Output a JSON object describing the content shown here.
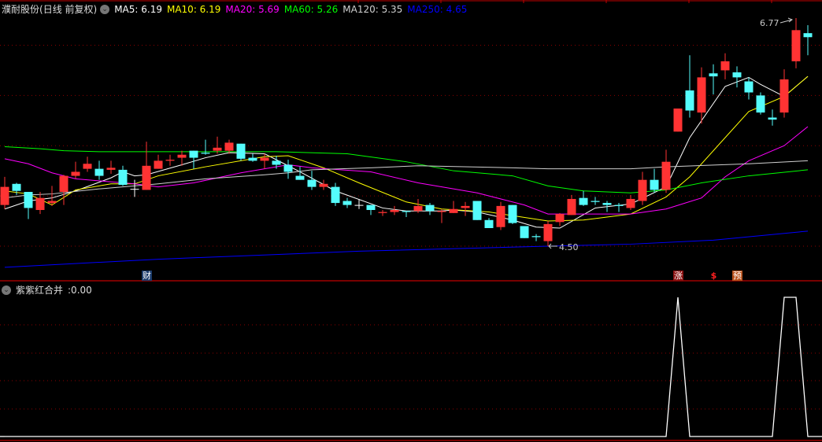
{
  "header": {
    "stock_name": "濮耐股份",
    "period": "(日线 前复权)",
    "ma_items": [
      {
        "label": "MA5: 6.19",
        "color": "#ffffff"
      },
      {
        "label": "MA10: 6.19",
        "color": "#ffff00"
      },
      {
        "label": "MA20: 5.69",
        "color": "#ff00ff"
      },
      {
        "label": "MA60: 5.26",
        "color": "#00ff00"
      },
      {
        "label": "MA120: 5.35",
        "color": "#d0d0d0"
      },
      {
        "label": "MA250: 4.65",
        "color": "#0000ff"
      }
    ]
  },
  "annotations": {
    "high_label": "6.77",
    "low_label": "4.50"
  },
  "markers": [
    {
      "text": "财",
      "index": 12,
      "bg": "#1a3a6a",
      "color": "#ffffff"
    },
    {
      "text": "涨",
      "index": 57,
      "bg": "#8a1010",
      "color": "#ffffff"
    },
    {
      "text": "$",
      "index": 60,
      "bg": "",
      "color": "#ff2020"
    },
    {
      "text": "预",
      "index": 62,
      "bg": "#b8501a",
      "color": "#ffffff"
    }
  ],
  "indicator": {
    "name": "紫紫红合并",
    "value_label": ":0.00"
  },
  "colors": {
    "up": "#ff3333",
    "down": "#54fcfc",
    "grid": "#8b0000",
    "border": "#c00000"
  },
  "chart_data": {
    "type": "candlestick",
    "price_range": [
      4.5,
      6.77
    ],
    "candles_ohlc": [
      [
        4.91,
        5.19,
        4.87,
        5.09
      ],
      [
        5.12,
        5.13,
        5.01,
        5.05
      ],
      [
        5.04,
        5.04,
        4.77,
        4.88
      ],
      [
        4.86,
        5.04,
        4.82,
        4.98
      ],
      [
        4.93,
        5.1,
        4.9,
        4.95
      ],
      [
        5.04,
        5.21,
        4.91,
        5.2
      ],
      [
        5.2,
        5.34,
        5.17,
        5.24
      ],
      [
        5.27,
        5.39,
        5.24,
        5.32
      ],
      [
        5.27,
        5.35,
        5.16,
        5.2
      ],
      [
        5.26,
        5.35,
        5.22,
        5.28
      ],
      [
        5.26,
        5.3,
        5.1,
        5.11
      ],
      [
        5.07,
        5.16,
        4.99,
        5.07
      ],
      [
        5.06,
        5.54,
        5.06,
        5.3
      ],
      [
        5.27,
        5.41,
        5.27,
        5.35
      ],
      [
        5.35,
        5.41,
        5.3,
        5.36
      ],
      [
        5.38,
        5.45,
        5.3,
        5.41
      ],
      [
        5.45,
        5.45,
        5.27,
        5.38
      ],
      [
        5.43,
        5.56,
        5.41,
        5.42
      ],
      [
        5.45,
        5.59,
        5.42,
        5.48
      ],
      [
        5.45,
        5.56,
        5.42,
        5.53
      ],
      [
        5.52,
        5.52,
        5.35,
        5.37
      ],
      [
        5.38,
        5.42,
        5.34,
        5.35
      ],
      [
        5.35,
        5.42,
        5.27,
        5.38
      ],
      [
        5.35,
        5.4,
        5.27,
        5.31
      ],
      [
        5.31,
        5.36,
        5.17,
        5.24
      ],
      [
        5.2,
        5.29,
        5.16,
        5.16
      ],
      [
        5.16,
        5.25,
        5.06,
        5.09
      ],
      [
        5.09,
        5.16,
        5.06,
        5.12
      ],
      [
        5.09,
        5.13,
        4.9,
        4.93
      ],
      [
        4.95,
        4.98,
        4.88,
        4.91
      ],
      [
        4.91,
        4.97,
        4.87,
        4.91
      ],
      [
        4.91,
        4.91,
        4.81,
        4.86
      ],
      [
        4.83,
        4.86,
        4.8,
        4.84
      ],
      [
        4.84,
        4.9,
        4.81,
        4.86
      ],
      [
        4.85,
        4.85,
        4.79,
        4.84
      ],
      [
        4.85,
        4.97,
        4.83,
        4.9
      ],
      [
        4.91,
        4.93,
        4.81,
        4.85
      ],
      [
        4.84,
        4.87,
        4.73,
        4.85
      ],
      [
        4.83,
        4.95,
        4.83,
        4.87
      ],
      [
        4.88,
        4.94,
        4.8,
        4.9
      ],
      [
        4.95,
        4.95,
        4.76,
        4.76
      ],
      [
        4.76,
        4.78,
        4.68,
        4.68
      ],
      [
        4.69,
        4.94,
        4.66,
        4.9
      ],
      [
        4.91,
        4.91,
        4.72,
        4.73
      ],
      [
        4.7,
        4.7,
        4.58,
        4.58
      ],
      [
        4.6,
        4.62,
        4.55,
        4.59
      ],
      [
        4.55,
        4.75,
        4.5,
        4.72
      ],
      [
        4.74,
        4.83,
        4.7,
        4.82
      ],
      [
        4.81,
        5.01,
        4.81,
        4.97
      ],
      [
        4.98,
        5.05,
        4.9,
        4.91
      ],
      [
        4.95,
        4.99,
        4.91,
        4.94
      ],
      [
        4.93,
        4.95,
        4.84,
        4.91
      ],
      [
        4.91,
        4.93,
        4.84,
        4.9
      ],
      [
        4.88,
        5.01,
        4.86,
        4.97
      ],
      [
        4.95,
        5.24,
        4.91,
        5.16
      ],
      [
        5.16,
        5.27,
        5.03,
        5.06
      ],
      [
        5.06,
        5.46,
        5.03,
        5.34
      ],
      [
        5.64,
        5.87,
        5.64,
        5.87
      ],
      [
        6.05,
        6.4,
        5.78,
        5.85
      ],
      [
        5.83,
        6.28,
        5.72,
        6.18
      ],
      [
        6.22,
        6.31,
        6.01,
        6.19
      ],
      [
        6.25,
        6.42,
        6.16,
        6.34
      ],
      [
        6.23,
        6.29,
        6.08,
        6.18
      ],
      [
        6.14,
        6.18,
        5.96,
        6.03
      ],
      [
        6.0,
        6.03,
        5.81,
        5.83
      ],
      [
        5.78,
        5.86,
        5.7,
        5.76
      ],
      [
        5.83,
        6.26,
        5.78,
        6.16
      ],
      [
        6.34,
        6.77,
        6.27,
        6.65
      ],
      [
        6.62,
        6.7,
        6.4,
        6.58
      ]
    ],
    "ma_series": [
      {
        "name": "MA5",
        "color": "#ffffff",
        "points": [
          [
            0,
            4.87
          ],
          [
            2,
            4.95
          ],
          [
            4,
            4.98
          ],
          [
            6,
            5.05
          ],
          [
            9,
            5.18
          ],
          [
            10,
            5.24
          ],
          [
            11,
            5.2
          ],
          [
            12,
            5.21
          ],
          [
            15,
            5.31
          ],
          [
            17,
            5.38
          ],
          [
            19,
            5.43
          ],
          [
            22,
            5.42
          ],
          [
            23,
            5.36
          ],
          [
            25,
            5.24
          ],
          [
            28,
            5.05
          ],
          [
            32,
            4.88
          ],
          [
            34,
            4.85
          ],
          [
            37,
            4.85
          ],
          [
            38,
            4.86
          ],
          [
            40,
            4.84
          ],
          [
            43,
            4.76
          ],
          [
            45,
            4.69
          ],
          [
            47,
            4.68
          ],
          [
            50,
            4.88
          ],
          [
            53,
            4.92
          ],
          [
            56,
            5.09
          ],
          [
            58,
            5.58
          ],
          [
            61,
            6.09
          ],
          [
            63,
            6.18
          ],
          [
            64,
            6.11
          ],
          [
            66,
            5.99
          ],
          [
            68,
            6.19
          ]
        ]
      },
      {
        "name": "MA10",
        "color": "#ffff00",
        "points": [
          [
            0,
            5.05
          ],
          [
            2,
            5.02
          ],
          [
            4,
            4.91
          ],
          [
            6,
            5.06
          ],
          [
            9,
            5.12
          ],
          [
            11,
            5.12
          ],
          [
            13,
            5.2
          ],
          [
            17,
            5.29
          ],
          [
            22,
            5.39
          ],
          [
            24,
            5.4
          ],
          [
            27,
            5.28
          ],
          [
            30,
            5.13
          ],
          [
            34,
            4.94
          ],
          [
            37,
            4.87
          ],
          [
            41,
            4.84
          ],
          [
            46,
            4.75
          ],
          [
            49,
            4.76
          ],
          [
            53,
            4.82
          ],
          [
            56,
            4.99
          ],
          [
            58,
            5.19
          ],
          [
            61,
            5.58
          ],
          [
            63,
            5.84
          ],
          [
            66,
            5.99
          ],
          [
            68,
            6.19
          ]
        ]
      },
      {
        "name": "MA20",
        "color": "#ff00ff",
        "points": [
          [
            0,
            5.37
          ],
          [
            2,
            5.32
          ],
          [
            4,
            5.23
          ],
          [
            6,
            5.17
          ],
          [
            11,
            5.12
          ],
          [
            13,
            5.09
          ],
          [
            16,
            5.13
          ],
          [
            20,
            5.23
          ],
          [
            24,
            5.31
          ],
          [
            26,
            5.28
          ],
          [
            31,
            5.24
          ],
          [
            35,
            5.13
          ],
          [
            40,
            5.03
          ],
          [
            44,
            4.91
          ],
          [
            46,
            4.82
          ],
          [
            53,
            4.82
          ],
          [
            56,
            4.87
          ],
          [
            59,
            4.98
          ],
          [
            61,
            5.19
          ],
          [
            63,
            5.35
          ],
          [
            66,
            5.5
          ],
          [
            68,
            5.69
          ]
        ]
      },
      {
        "name": "MA60",
        "color": "#00ff00",
        "points": [
          [
            0,
            5.49
          ],
          [
            3,
            5.47
          ],
          [
            5,
            5.45
          ],
          [
            8,
            5.44
          ],
          [
            23,
            5.44
          ],
          [
            29,
            5.42
          ],
          [
            34,
            5.34
          ],
          [
            38,
            5.25
          ],
          [
            43,
            5.2
          ],
          [
            46,
            5.1
          ],
          [
            49,
            5.05
          ],
          [
            53,
            5.03
          ],
          [
            56,
            5.06
          ],
          [
            59,
            5.13
          ],
          [
            63,
            5.2
          ],
          [
            68,
            5.26
          ]
        ]
      },
      {
        "name": "MA120",
        "color": "#d0d0d0",
        "points": [
          [
            0,
            4.98
          ],
          [
            2,
            5.01
          ],
          [
            4,
            5.02
          ],
          [
            8,
            5.07
          ],
          [
            13,
            5.12
          ],
          [
            17,
            5.17
          ],
          [
            22,
            5.21
          ],
          [
            24,
            5.23
          ],
          [
            26,
            5.26
          ],
          [
            31,
            5.28
          ],
          [
            35,
            5.3
          ],
          [
            43,
            5.28
          ],
          [
            46,
            5.27
          ],
          [
            53,
            5.27
          ],
          [
            56,
            5.29
          ],
          [
            63,
            5.32
          ],
          [
            68,
            5.35
          ]
        ]
      },
      {
        "name": "MA250",
        "color": "#0000ff",
        "points": [
          [
            0,
            4.29
          ],
          [
            13,
            4.37
          ],
          [
            30,
            4.45
          ],
          [
            46,
            4.5
          ],
          [
            53,
            4.52
          ],
          [
            60,
            4.56
          ],
          [
            68,
            4.65
          ]
        ]
      }
    ],
    "indicator_values": [
      0,
      0,
      0,
      0,
      0,
      0,
      0,
      0,
      0,
      0,
      0,
      0,
      0,
      0,
      0,
      0,
      0,
      0,
      0,
      0,
      0,
      0,
      0,
      0,
      0,
      0,
      0,
      0,
      0,
      0,
      0,
      0,
      0,
      0,
      0,
      0,
      0,
      0,
      0,
      0,
      0,
      0,
      0,
      0,
      0,
      0,
      0,
      0,
      0,
      0,
      0,
      0,
      0,
      0,
      0,
      0,
      0,
      1,
      0,
      0,
      0,
      0,
      0,
      0,
      0,
      0,
      1,
      1,
      0
    ]
  }
}
